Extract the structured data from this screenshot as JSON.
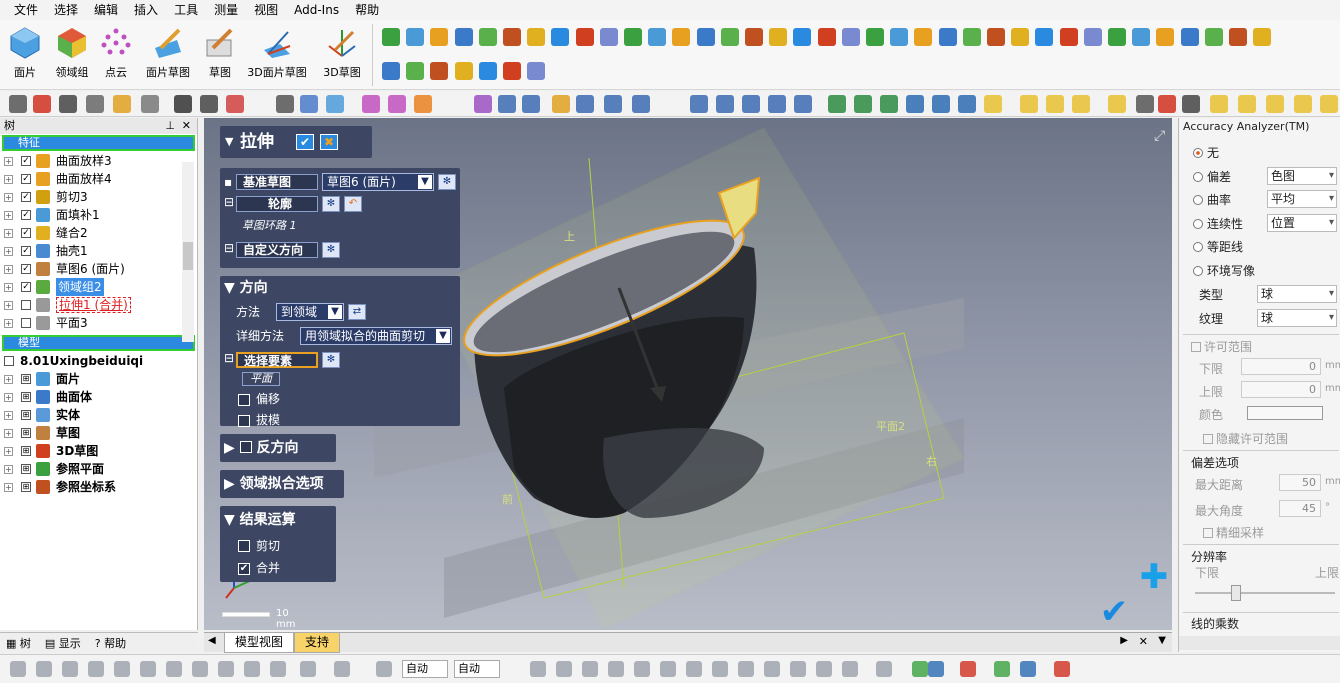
{
  "menu": [
    "文件",
    "选择",
    "编辑",
    "插入",
    "工具",
    "测量",
    "视图",
    "Add-Ins",
    "帮助"
  ],
  "ribbon": {
    "big": [
      "面片",
      "领域组",
      "点云",
      "面片草图",
      "草图",
      "3D面片草图",
      "3D草图"
    ]
  },
  "left": {
    "tree_header": "树",
    "features_label": "特征",
    "features": [
      {
        "label": "曲面放样3",
        "color": "#e8a020"
      },
      {
        "label": "曲面放样4",
        "color": "#e8a020"
      },
      {
        "label": "剪切3",
        "color": "#d0a010"
      },
      {
        "label": "面填补1",
        "color": "#4a9ad8"
      },
      {
        "label": "缝合2",
        "color": "#e0b020"
      },
      {
        "label": "抽壳1",
        "color": "#4a8ad0"
      },
      {
        "label": "草图6 (面片)",
        "color": "#c08040"
      },
      {
        "label": "领域组2",
        "color": "#5aaa40"
      },
      {
        "label": "拉伸1 (合并)",
        "color": "#999999"
      },
      {
        "label": "平面3",
        "color": "#9a9a9a"
      }
    ],
    "model_label": "模型",
    "model_root": "8.01Uxingbeiduiqi",
    "model_items": [
      {
        "label": "面片",
        "color": "#4a9ad8"
      },
      {
        "label": "曲面体",
        "color": "#3a7ac8"
      },
      {
        "label": "实体",
        "color": "#5a9ad8"
      },
      {
        "label": "草图",
        "color": "#c08040"
      },
      {
        "label": "3D草图",
        "color": "#d04020"
      },
      {
        "label": "参照平面",
        "color": "#3aa040"
      },
      {
        "label": "参照坐标系",
        "color": "#c05020"
      }
    ],
    "tabs": [
      "树",
      "显示",
      "帮助"
    ]
  },
  "extrude": {
    "title": "拉伸",
    "base_sketch_label": "基准草图",
    "base_sketch_value": "草图6 (面片)",
    "profile_label": "轮廓",
    "profile_item": "草图环路 1",
    "custom_dir_label": "自定义方向",
    "direction_label": "方向",
    "method_label": "方法",
    "method_value": "到领域",
    "detail_label": "详细方法",
    "detail_value": "用领域拟合的曲面剪切",
    "select_elem_label": "选择要素",
    "select_elem_item": "平面",
    "offset_label": "偏移",
    "draft_label": "拔模",
    "reverse_label": "反方向",
    "region_fit_label": "领域拟合选项",
    "result_label": "结果运算",
    "cut_label": "剪切",
    "merge_label": "合并",
    "scale_label": "10 mm"
  },
  "viewport": {
    "labels": {
      "top": "上",
      "front": "前",
      "right": "右",
      "plane2": "平面2"
    }
  },
  "right": {
    "title": "Accuracy Analyzer(TM)",
    "options": [
      {
        "label": "无",
        "on": true,
        "value": ""
      },
      {
        "label": "偏差",
        "on": false,
        "value": "色图"
      },
      {
        "label": "曲率",
        "on": false,
        "value": "平均"
      },
      {
        "label": "连续性",
        "on": false,
        "value": "位置"
      },
      {
        "label": "等距线",
        "on": false,
        "value": ""
      },
      {
        "label": "环境写像",
        "on": false,
        "value": ""
      }
    ],
    "type_label": "类型",
    "type_value": "球",
    "texture_label": "纹理",
    "texture_value": "球",
    "tolerance_label": "许可范围",
    "lower_label": "下限",
    "lower_value": "0",
    "lower_unit": "mm",
    "upper_label": "上限",
    "upper_value": "0",
    "upper_unit": "mm",
    "color_label": "颜色",
    "hide_tol_label": "隐藏许可范围",
    "deviation_opts": "偏差选项",
    "max_dist_label": "最大距离",
    "max_dist_value": "50",
    "max_dist_unit": "mm",
    "max_angle_label": "最大角度",
    "max_angle_value": "45",
    "max_angle_unit": "°",
    "fine_label": "精细采样",
    "resolution_label": "分辨率",
    "res_lower": "下限",
    "res_upper": "上限",
    "line_mult": "线的乘数"
  },
  "bottom": {
    "tabs": [
      "模型视图",
      "支持"
    ]
  },
  "status": {
    "auto1": "自动",
    "auto2": "自动"
  }
}
